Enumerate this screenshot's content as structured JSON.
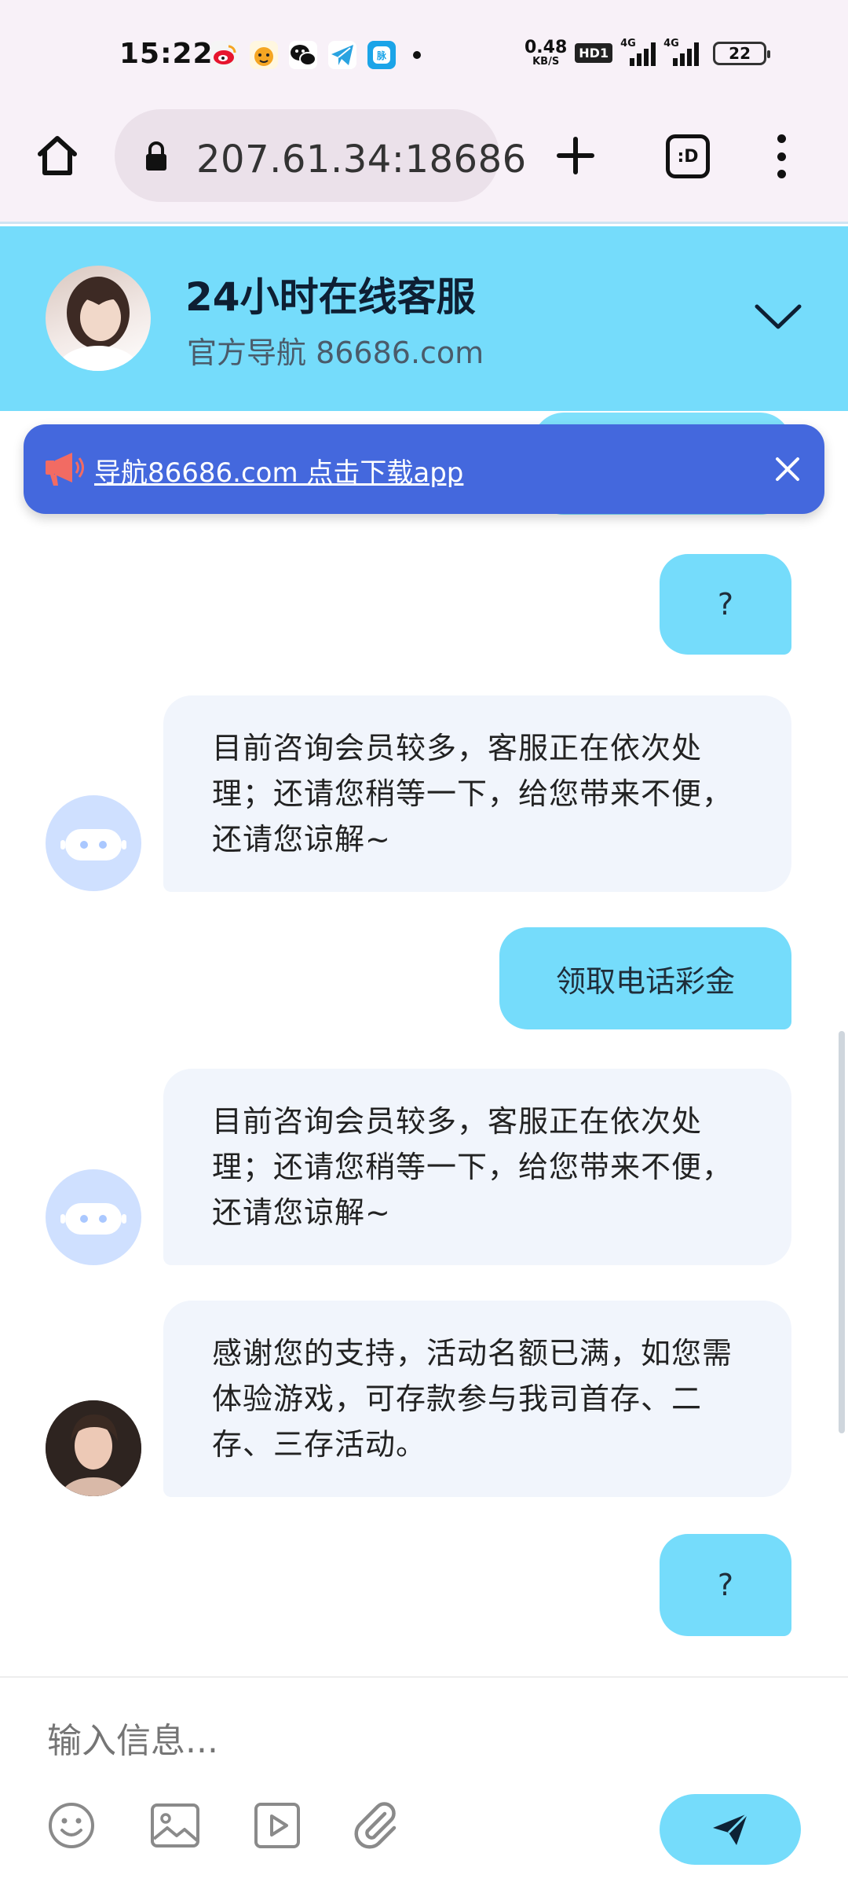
{
  "status_bar": {
    "time": "15:22",
    "speed_value": "0.48",
    "speed_unit": "KB/S",
    "hd_label": "HD1",
    "signal_label_1": "4G",
    "signal_label_2": "4G",
    "battery": "22",
    "app_icons": [
      "weibo-icon",
      "tiger-app-icon",
      "wechat-icon",
      "telegram-icon",
      "app-icon"
    ]
  },
  "browser": {
    "url": "207.61.34:18686",
    "tabs_label": ":D"
  },
  "chat_header": {
    "title": "24小时在线客服",
    "subtitle": "官方导航 86686.com"
  },
  "notice": {
    "text": "导航86686.com 点击下载app"
  },
  "messages": [
    {
      "from": "user",
      "text": "?"
    },
    {
      "from": "bot",
      "text": "目前咨询会员较多，客服正在依次处理；还请您稍等一下，给您带来不便，还请您谅解~"
    },
    {
      "from": "user",
      "text": "领取电话彩金"
    },
    {
      "from": "bot",
      "text": "目前咨询会员较多，客服正在依次处理；还请您稍等一下，给您带来不便，还请您谅解~"
    },
    {
      "from": "agent",
      "text": "感谢您的支持，活动名额已满，如您需体验游戏，可存款参与我司首存、二存、三存活动。"
    },
    {
      "from": "user",
      "text": "?"
    }
  ],
  "composer": {
    "placeholder": "输入信息...",
    "tools": [
      "emoji-icon",
      "image-icon",
      "video-icon",
      "attachment-icon"
    ]
  },
  "colors": {
    "header_bg": "#75dcfb",
    "user_bubble": "#75dcfb",
    "bot_bubble": "#f1f5fc",
    "notice_bg": "#4468dd",
    "browser_bg": "#f8f1f8"
  }
}
